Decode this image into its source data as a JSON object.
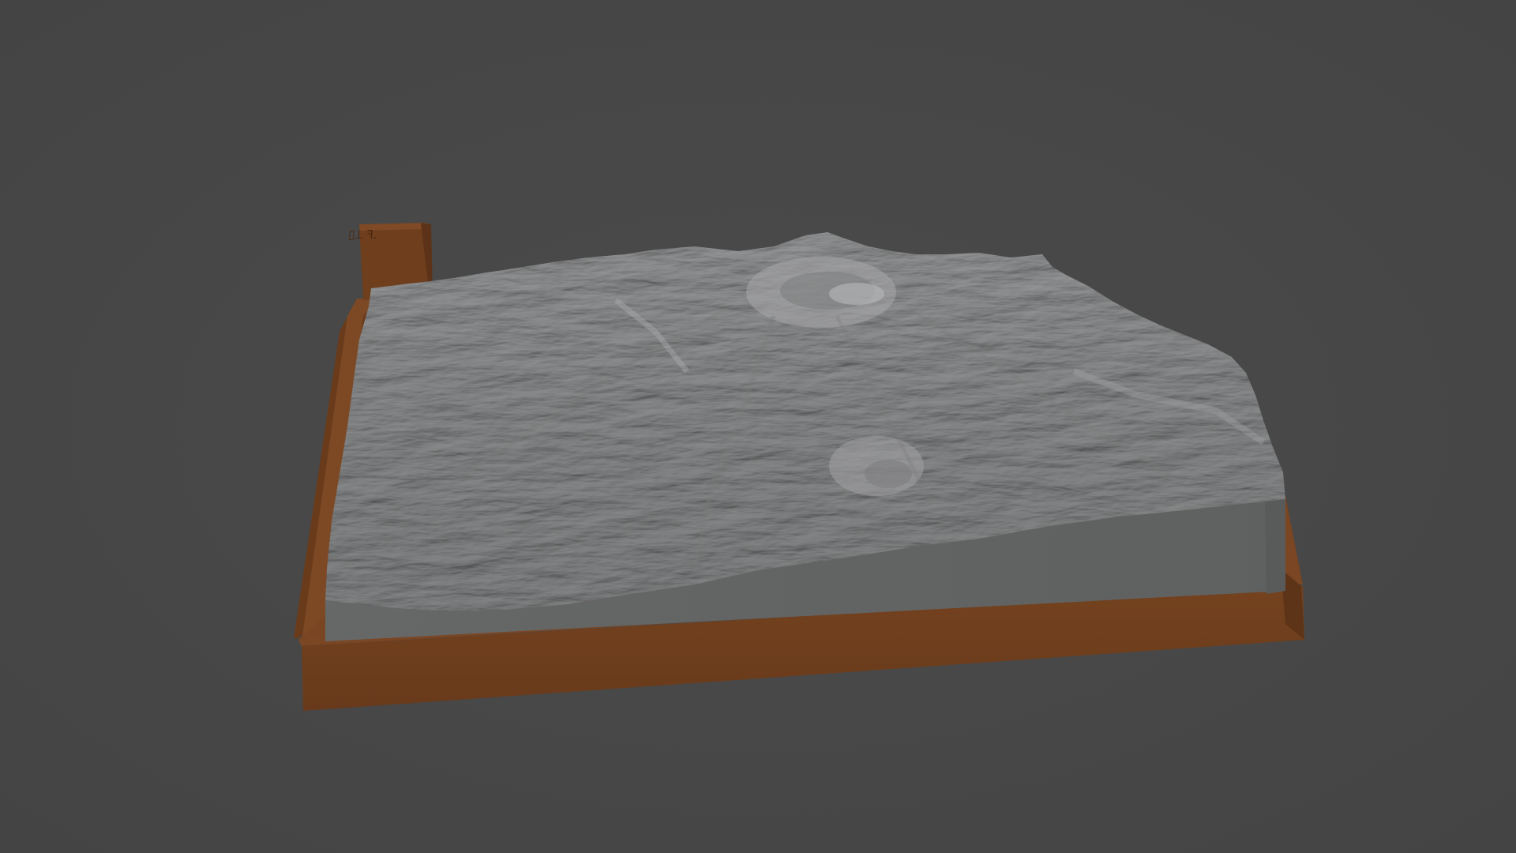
{
  "viewport": {
    "background_color": "#474747"
  },
  "model": {
    "base_color": "#6e3f1f",
    "base_top_color": "#7d4824",
    "terrain_color": "#8f9091",
    "terrain_side_color": "#636565",
    "label_block": {
      "engraving": "▯⟂ ꟻ."
    }
  }
}
